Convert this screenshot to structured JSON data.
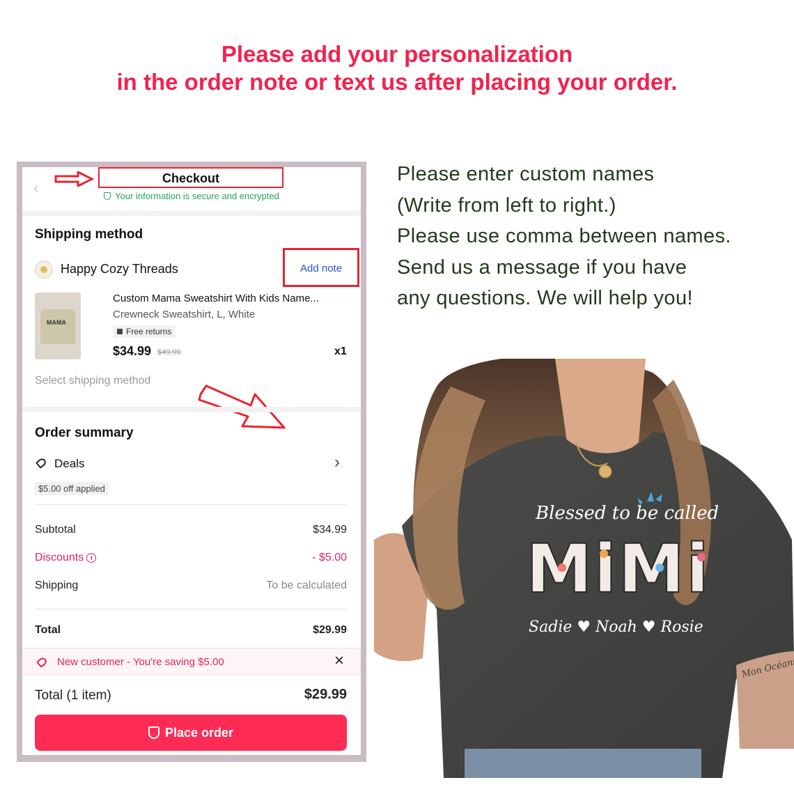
{
  "banner": {
    "line1": "Please add your personalization",
    "line2": "in the order note or text us after placing your order."
  },
  "checkout": {
    "title": "Checkout",
    "secure_text": "Your information is secure and encrypted",
    "shipping_method_title": "Shipping method",
    "store_name": "Happy Cozy Threads",
    "add_note": "Add note",
    "product": {
      "title": "Custom Mama Sweatshirt With Kids Name...",
      "variant": "Crewneck Sweatshirt, L, White",
      "badge": "Free returns",
      "price": "$34.99",
      "old_price": "$49.99",
      "qty": "x1",
      "thumb_text": "MAMA"
    },
    "select_shipping": "Select shipping method",
    "order_summary_title": "Order summary",
    "deals_label": "Deals",
    "deals_applied": "$5.00 off applied",
    "rows": [
      {
        "label": "Subtotal",
        "value": "$34.99"
      },
      {
        "label": "Discounts",
        "value": "- $5.00"
      },
      {
        "label": "Shipping",
        "value": "To be calculated"
      },
      {
        "label": "Total",
        "value": "$29.99"
      }
    ],
    "promo": "New customer - You're saving $5.00",
    "total_items_label": "Total (1 item)",
    "total_items_value": "$29.99",
    "place_order": "Place order"
  },
  "instructions": [
    "Please enter custom names",
    "(Write from left to right.)",
    "Please use comma between names.",
    "Send us a message if you have",
    "any questions. We will help you!"
  ],
  "shirt": {
    "line1": "Blessed to be called",
    "big": "MiMi",
    "names": "Sadie ♥ Noah ♥ Rosie",
    "tattoo": "Mon Océans"
  },
  "colors": {
    "banner_red": "#f0234e",
    "place_order_pink": "#fe2c55",
    "discount_pink": "#e0245e",
    "link_blue": "#2a56c6",
    "annotation_red": "#e8232f",
    "instructions_green": "#233a1c",
    "secure_green": "#27a35a"
  }
}
